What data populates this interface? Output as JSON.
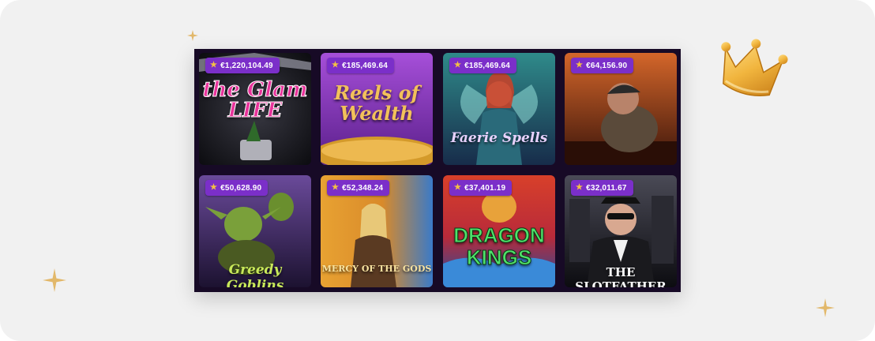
{
  "games": [
    {
      "name": "the Glam LIFE",
      "jackpot": "€1,220,104.49",
      "bg1": "#2a2a30",
      "bg2": "#0f0f12",
      "accent": "#e8339b"
    },
    {
      "name": "Reels of Wealth",
      "jackpot": "€185,469.64",
      "bg1": "#9b3fd1",
      "bg2": "#5a1f8a",
      "accent": "#f2c15a"
    },
    {
      "name": "Faerie Spells",
      "jackpot": "€185,469.64",
      "bg1": "#2f7a7a",
      "bg2": "#172c4a",
      "accent": "#d9b6ff"
    },
    {
      "name": "",
      "jackpot": "€64,156.90",
      "bg1": "#c2541e",
      "bg2": "#4a1a0c",
      "accent": "#f0d27a"
    },
    {
      "name": "Greedy Goblins",
      "jackpot": "€50,628.90",
      "bg1": "#6a4a8a",
      "bg2": "#23183a",
      "accent": "#c8e85a"
    },
    {
      "name": "MERCY OF THE GODS",
      "jackpot": "€52,348.24",
      "bg1": "#e8a232",
      "bg2": "#3a6ab8",
      "accent": "#f7e2a0"
    },
    {
      "name": "DRAGON KINGS",
      "jackpot": "€37,401.19",
      "bg1": "#c8332e",
      "bg2": "#1d4fa0",
      "accent": "#4fe06a"
    },
    {
      "name": "THE SLOTFATHER",
      "jackpot": "€32,011.67",
      "bg1": "#3a3a44",
      "bg2": "#0d0d10",
      "accent": "#ffffff"
    }
  ]
}
